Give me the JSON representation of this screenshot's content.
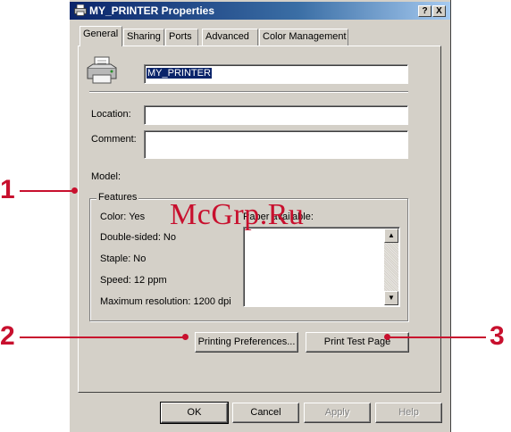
{
  "window": {
    "title": "MY_PRINTER Properties",
    "help_button": "?",
    "close_button": "X"
  },
  "tabs": [
    "General",
    "Sharing",
    "Ports",
    "Advanced",
    "Color Management"
  ],
  "general": {
    "printer_name": "MY_PRINTER",
    "location_label": "Location:",
    "location_value": "",
    "comment_label": "Comment:",
    "comment_value": "",
    "model_label": "Model:"
  },
  "features": {
    "title": "Features",
    "color": "Color: Yes",
    "double_sided": "Double-sided: No",
    "staple": "Staple: No",
    "speed": "Speed: 12 ppm",
    "max_resolution": "Maximum resolution: 1200 dpi",
    "paper_available_label": "Paper available:"
  },
  "buttons": {
    "printing_preferences": "Printing Preferences...",
    "print_test_page": "Print Test Page",
    "ok": "OK",
    "cancel": "Cancel",
    "apply": "Apply",
    "help": "Help"
  },
  "callouts": [
    "1",
    "2",
    "3"
  ],
  "watermark": "McGrp.Ru",
  "colors": {
    "callout": "#c8102e",
    "title_bar": "#0a246a",
    "dialog_face": "#d4d0c8"
  }
}
